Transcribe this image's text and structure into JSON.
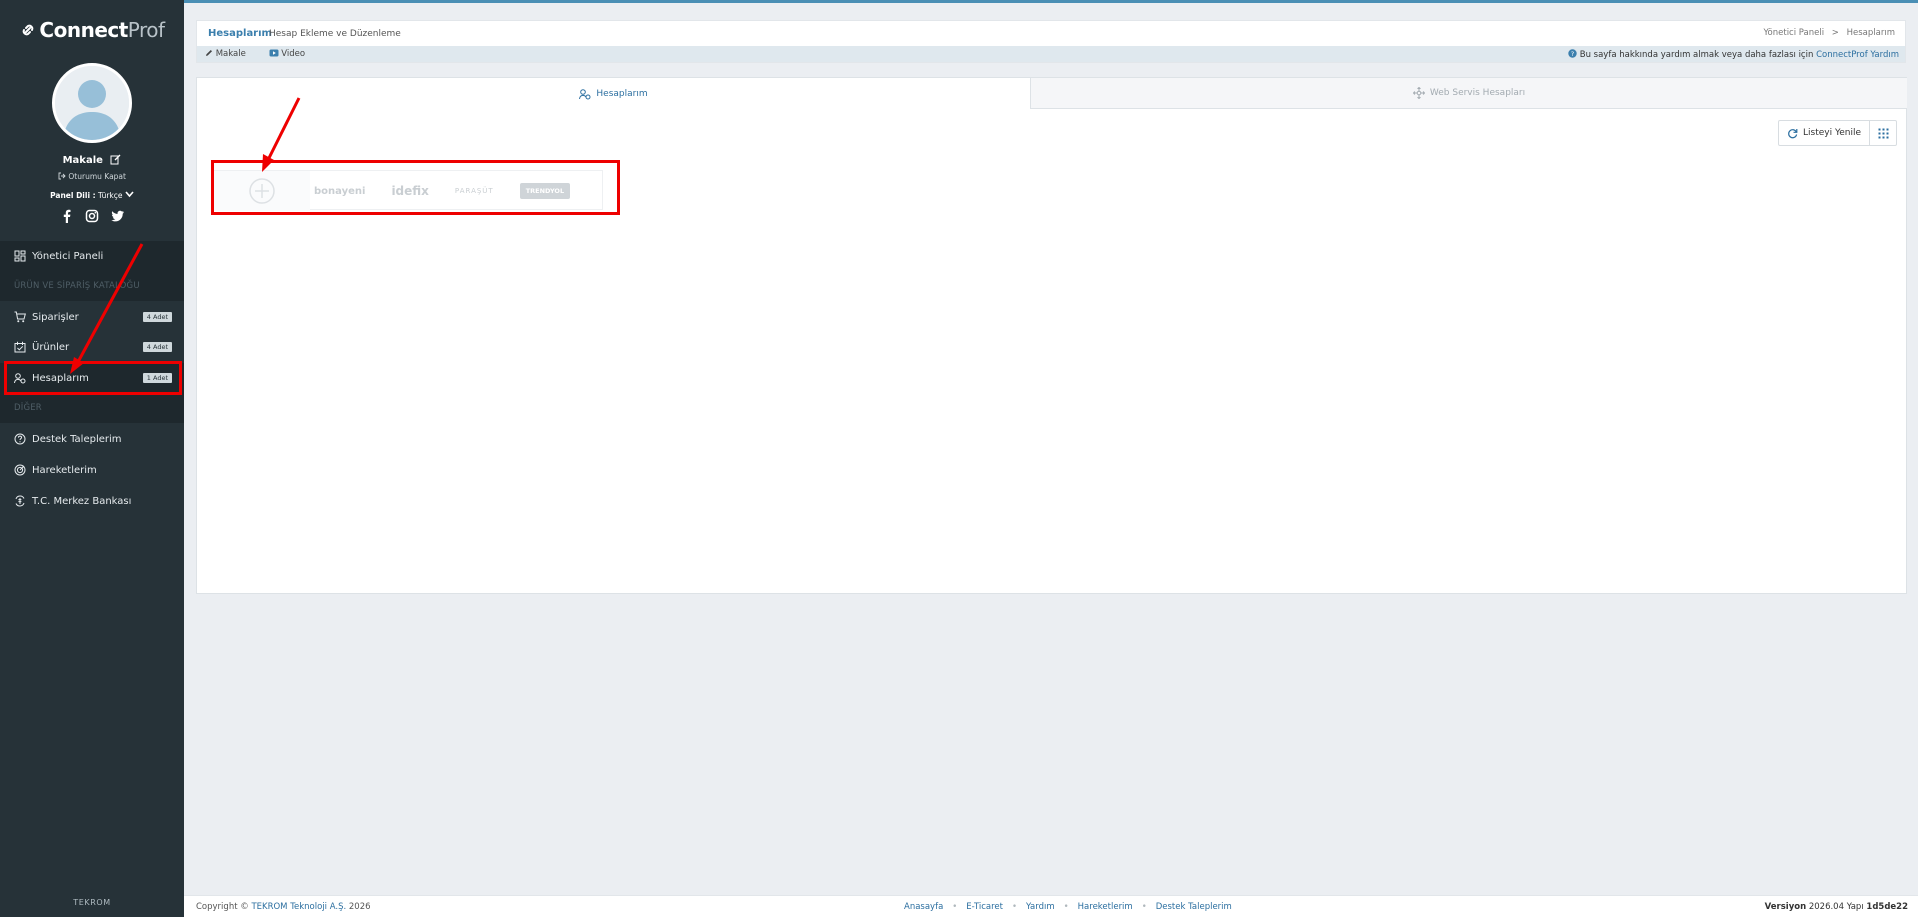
{
  "brand": {
    "name_bold": "Connect",
    "name_light": "Prof"
  },
  "user": {
    "name": "Makale",
    "logout_label": "Oturumu Kapat",
    "lang_label": "Panel Dili :",
    "lang_value": "Türkçe"
  },
  "sidebar": {
    "items": [
      {
        "label": "Yönetici Paneli",
        "icon": "dashboard-icon"
      },
      {
        "label": "Siparişler",
        "icon": "cart-icon",
        "badge": "4 Adet"
      },
      {
        "label": "Ürünler",
        "icon": "box-icon",
        "badge": "4 Adet"
      },
      {
        "label": "Hesaplarım",
        "icon": "user-account-icon",
        "badge": "1 Adet"
      },
      {
        "label": "Destek Taleplerim",
        "icon": "question-icon"
      },
      {
        "label": "Hareketlerim",
        "icon": "activity-icon"
      },
      {
        "label": "T.C. Merkez Bankası",
        "icon": "currency-icon"
      }
    ],
    "sections": [
      "ÜRÜN VE SİPARİŞ KATALOĞU",
      "DİĞER"
    ],
    "footer": "TEKROM"
  },
  "header": {
    "title": "Hesaplarım",
    "subtitle": "Hesap Ekleme ve Düzenleme",
    "breadcrumb_home": "Yönetici Paneli",
    "breadcrumb_sep": ">",
    "breadcrumb_current": "Hesaplarım"
  },
  "subbar": {
    "article_label": "Makale",
    "video_label": "Video",
    "help_text": "Bu sayfa hakkında yardım almak veya daha fazlası için",
    "help_link": "ConnectProf Yardım"
  },
  "tabs": [
    {
      "label": "Hesaplarım",
      "active": true
    },
    {
      "label": "Web Servis Hesapları",
      "active": false
    }
  ],
  "toolbar": {
    "refresh_label": "Listeyi Yenile"
  },
  "account_card": {
    "logos": [
      "bonayeni",
      "idefix",
      "PARAŞÜT",
      "TRENDYOL"
    ]
  },
  "footer": {
    "copyright_prefix": "Copyright ©",
    "company": "TEKROM Teknoloji A.Ş.",
    "year": "2026",
    "links": [
      "Anasayfa",
      "E-Ticaret",
      "Yardım",
      "Hareketlerim",
      "Destek Taleplerim"
    ],
    "version_label": "Versiyon",
    "version_value": "2026.04",
    "build_label": "Yapı",
    "build_value": "1d5de22"
  },
  "colors": {
    "sidebar_bg": "#263238",
    "accent": "#2c6fa0",
    "annotation": "#ee0000"
  }
}
